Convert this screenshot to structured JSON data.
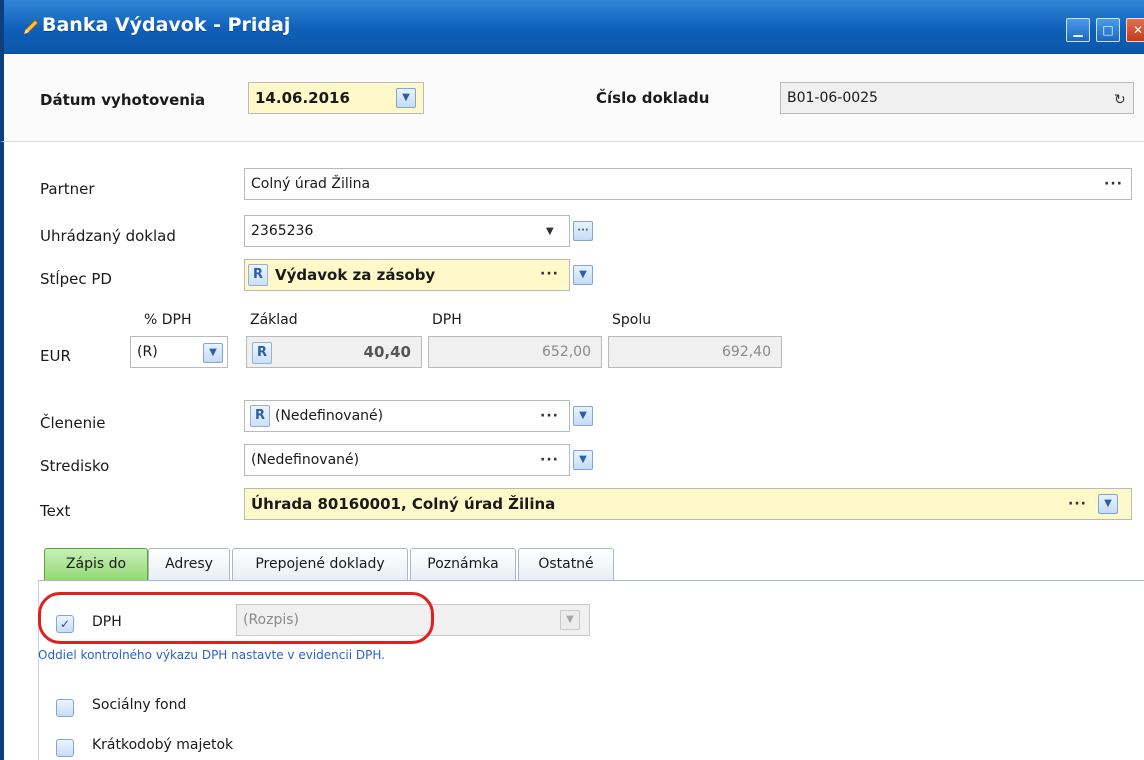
{
  "window": {
    "title": "Banka Výdavok - Pridaj",
    "colors": {
      "titlebar": "#1565c0",
      "highlight_field": "#fff8c8",
      "active_tab": "#8fd86f",
      "annotation": "#e02020",
      "note_text": "#2a63c9"
    }
  },
  "header": {
    "date_label": "Dátum vyhotovenia",
    "date_value": "14.06.2016",
    "doc_number_label": "Číslo dokladu",
    "doc_number_value": "B01-06-0025"
  },
  "form": {
    "partner_label": "Partner",
    "partner_value": "Colný úrad Žilina",
    "paid_doc_label": "Uhrádzaný doklad",
    "paid_doc_value": "2365236",
    "column_label": "Stĺpec PD",
    "column_badge": "R",
    "column_value": "Výdavok za zásoby",
    "currency_label": "EUR",
    "vat_pct_label": "% DPH",
    "vat_pct_value": "(R)",
    "base_label": "Základ",
    "base_badge": "R",
    "base_value": "40,40",
    "vat_label": "DPH",
    "vat_value": "652,00",
    "total_label": "Spolu",
    "total_value": "692,40",
    "division_label": "Členenie",
    "division_badge": "R",
    "division_value": "(Nedefinované)",
    "center_label": "Stredisko",
    "center_value": "(Nedefinované)",
    "text_label": "Text",
    "text_value": "Úhrada 80160001, Colný úrad Žilina"
  },
  "tabs": [
    {
      "label": "Zápis do",
      "active": true
    },
    {
      "label": "Adresy",
      "active": false
    },
    {
      "label": "Prepojené doklady",
      "active": false
    },
    {
      "label": "Poznámka",
      "active": false
    },
    {
      "label": "Ostatné",
      "active": false
    }
  ],
  "panel": {
    "vat_checkbox_label": "DPH",
    "vat_checked": true,
    "vat_mode_value": "(Rozpis)",
    "note": "Oddiel kontrolného výkazu DPH nastavte v evidencii DPH.",
    "social_fund_label": "Sociálny fond",
    "social_fund_checked": false,
    "short_term_assets_label": "Krátkodobý majetok",
    "short_term_assets_checked": false
  },
  "icons": {
    "title": "pencil-icon",
    "dropdown": "chevron-down-icon",
    "more": "ellipsis-icon",
    "refresh": "redo-arrow-icon",
    "check": "checkmark-icon"
  }
}
